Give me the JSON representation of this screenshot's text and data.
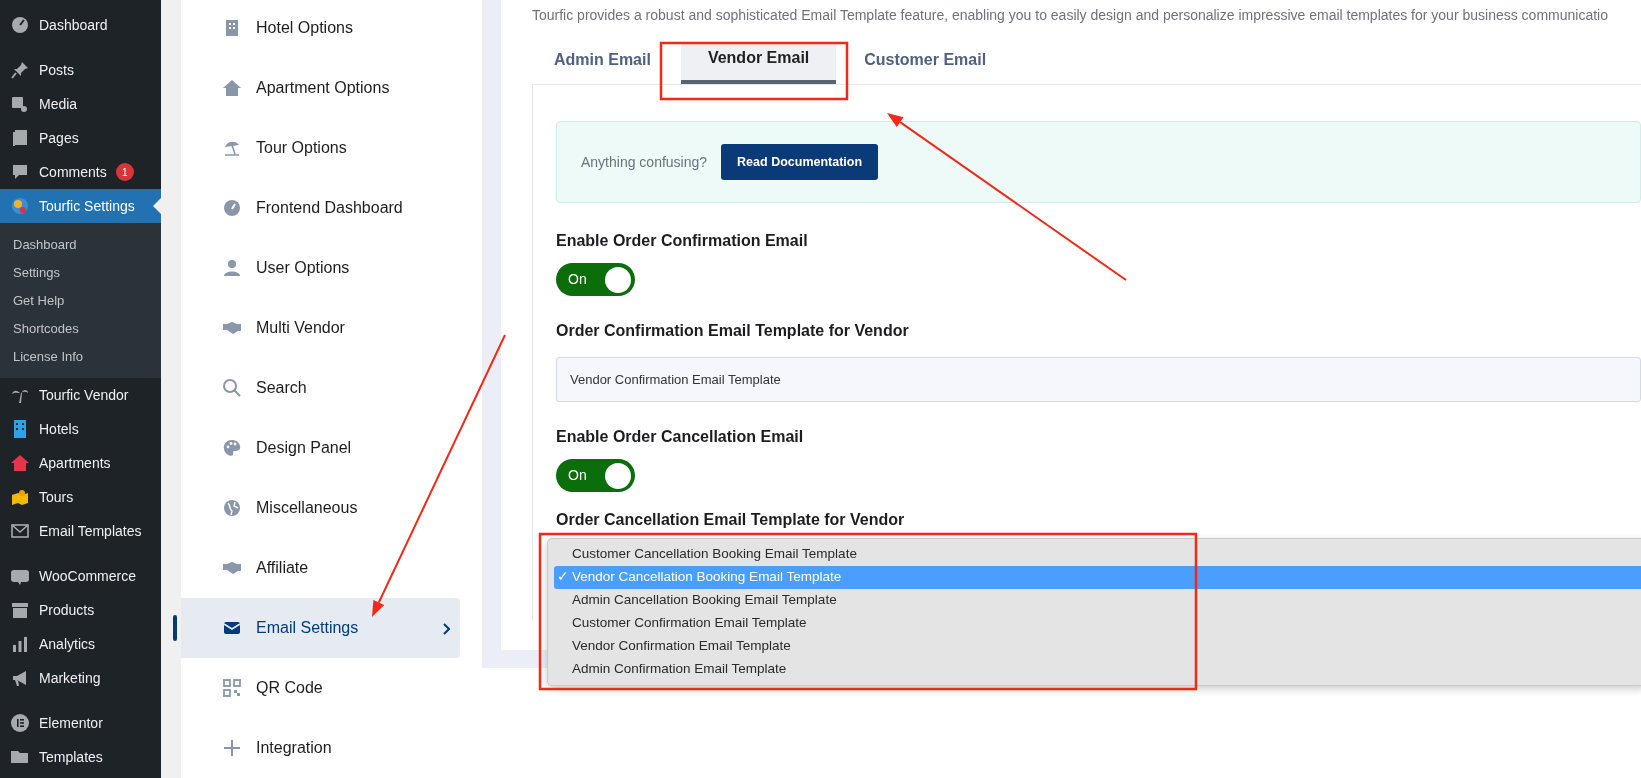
{
  "wp_menu": [
    [
      {
        "label": "Dashboard",
        "selected": false
      }
    ],
    [
      {
        "label": "Posts",
        "selected": false
      },
      {
        "label": "Media",
        "selected": false
      },
      {
        "label": "Pages",
        "selected": false
      },
      {
        "label": "Comments",
        "badge": "1",
        "selected": false
      },
      {
        "label": "Tourfic Settings",
        "selected": true,
        "submenu": [
          {
            "label": "Dashboard"
          },
          {
            "label": "Settings"
          },
          {
            "label": "Get Help"
          },
          {
            "label": "Shortcodes"
          },
          {
            "label": "License Info"
          }
        ]
      },
      {
        "label": "Tourfic Vendor",
        "selected": false
      },
      {
        "label": "Hotels",
        "selected": false
      },
      {
        "label": "Apartments",
        "selected": false
      },
      {
        "label": "Tours",
        "selected": false
      },
      {
        "label": "Email Templates",
        "selected": false
      }
    ],
    [
      {
        "label": "WooCommerce",
        "selected": false
      },
      {
        "label": "Products",
        "selected": false
      },
      {
        "label": "Analytics",
        "selected": false
      },
      {
        "label": "Marketing",
        "selected": false
      }
    ],
    [
      {
        "label": "Elementor",
        "selected": false
      },
      {
        "label": "Templates",
        "selected": false
      }
    ]
  ],
  "settings_nav": [
    {
      "label": "Hotel Options",
      "selected": false
    },
    {
      "label": "Apartment Options",
      "selected": false
    },
    {
      "label": "Tour Options",
      "selected": false
    },
    {
      "label": "Frontend Dashboard",
      "selected": false
    },
    {
      "label": "User Options",
      "selected": false
    },
    {
      "label": "Multi Vendor",
      "selected": false
    },
    {
      "label": "Search",
      "selected": false
    },
    {
      "label": "Design Panel",
      "selected": false
    },
    {
      "label": "Miscellaneous",
      "selected": false
    },
    {
      "label": "Affiliate",
      "selected": false
    },
    {
      "label": "Email Settings",
      "selected": true
    },
    {
      "label": "QR Code",
      "selected": false
    },
    {
      "label": "Integration",
      "selected": false
    }
  ],
  "description": "Tourfic provides a robust and sophisticated Email Template feature, enabling you to easily design and personalize impressive email templates for your business communicatio",
  "tabs": [
    {
      "label": "Admin Email",
      "selected": false
    },
    {
      "label": "Vendor Email",
      "selected": true
    },
    {
      "label": "Customer Email",
      "selected": false
    }
  ],
  "help_box": {
    "text": "Anything confusing?",
    "button": "Read Documentation"
  },
  "fields": [
    {
      "kind": "switch",
      "label": "Enable Order Confirmation Email",
      "on": true,
      "state_text": "On"
    },
    {
      "kind": "select",
      "label": "Order Confirmation Email Template for Vendor",
      "value": "Vendor Confirmation Email Template"
    },
    {
      "kind": "switch",
      "label": "Enable Order Cancellation Email",
      "on": true,
      "state_text": "On"
    },
    {
      "kind": "select",
      "label": "Order Cancellation Email Template for Vendor"
    }
  ],
  "dropdown": {
    "check": "✓",
    "options": [
      {
        "label": "Customer Cancellation Booking Email Template",
        "selected": false
      },
      {
        "label": "Vendor Cancellation Booking Email Template",
        "selected": true
      },
      {
        "label": "Admin Cancellation Booking Email Template",
        "selected": false
      },
      {
        "label": "Customer Confirmation Email Template",
        "selected": false
      },
      {
        "label": "Vendor Confirmation Email Template",
        "selected": false
      },
      {
        "label": "Admin Confirmation Email Template",
        "selected": false
      }
    ]
  },
  "annotations": [
    {
      "kind": "frame"
    },
    {
      "kind": "frame"
    },
    {
      "kind": "arrow"
    },
    {
      "kind": "arrow"
    }
  ]
}
